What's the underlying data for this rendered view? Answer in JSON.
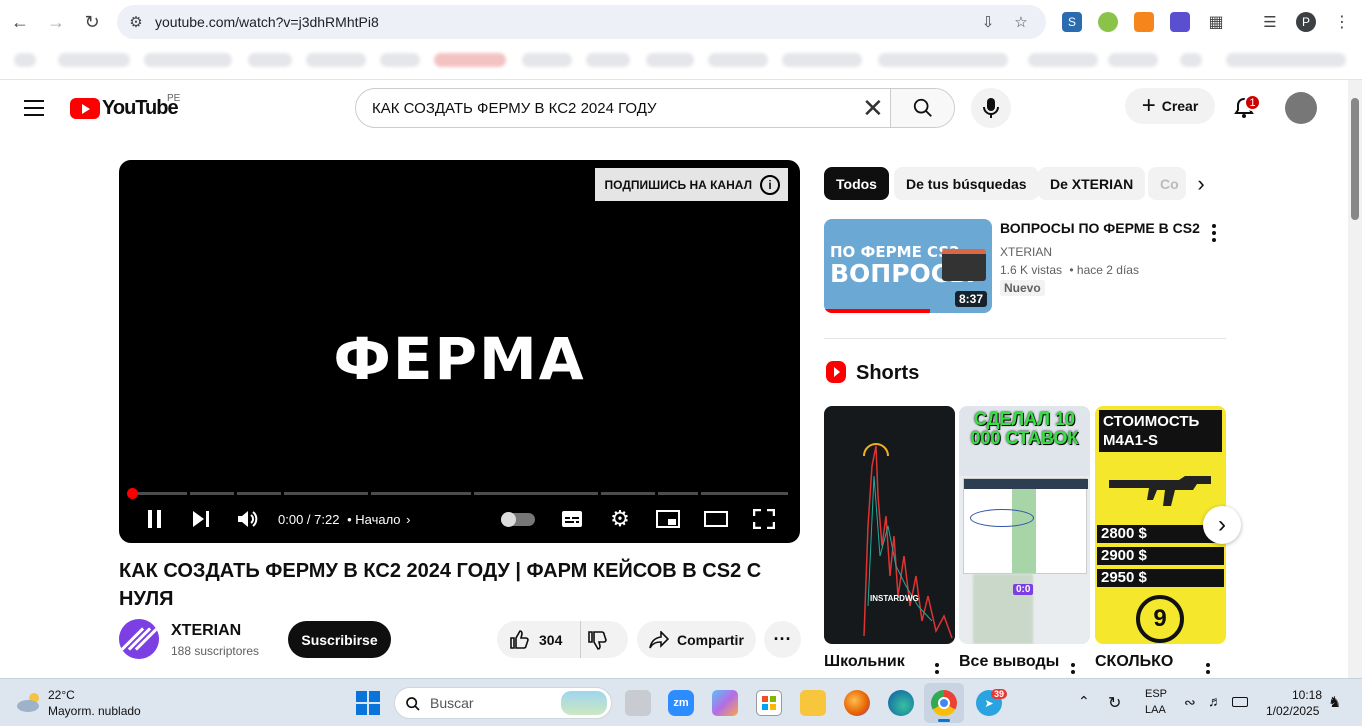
{
  "browser": {
    "url": "youtube.com/watch?v=j3dhRMhtPi8"
  },
  "header": {
    "logo_text": "YouTube",
    "country": "PE",
    "search_query": "КАК СОЗДАТЬ ФЕРМУ В КС2 2024 ГОДУ",
    "create_label": "Crear",
    "notification_count": "1"
  },
  "player": {
    "overlay_title": "ФЕРМА",
    "subscribe_banner": "ПОДПИШИСЬ НА КАНАЛ",
    "time": "0:00 / 7:22",
    "chapter": "• Начало",
    "progress": 0
  },
  "video": {
    "title": "КАК СОЗДАТЬ ФЕРМУ В КС2 2024 ГОДУ |  ФАРМ КЕЙСОВ В CS2 С НУЛЯ",
    "channel": "XTERIAN",
    "subscribers": "188 suscriptores",
    "subscribe_label": "Suscribirse",
    "likes": "304",
    "share_label": "Compartir"
  },
  "filters": {
    "chips": [
      "Todos",
      "De tus búsquedas",
      "De XTERIAN",
      "Co"
    ],
    "active": "Todos"
  },
  "recommended": {
    "thumb_line1": "ПО ФЕРМЕ CS2",
    "thumb_line2": "ВОПРОСЫ",
    "duration": "8:37",
    "title": "ВОПРОСЫ ПО ФЕРМЕ В CS2",
    "channel": "XTERIAN",
    "views": "1.6 K vistas",
    "age": "• hace 2 días",
    "badge": "Nuevo",
    "watch_progress": 0.63
  },
  "shorts": {
    "heading": "Shorts",
    "items": [
      {
        "title": "Школьник",
        "overlay": "INSTARDWG"
      },
      {
        "title": "Все выводы",
        "overlay": "СДЕЛАЛ 10 000 СТАВОК",
        "score": "0:0"
      },
      {
        "title": "СКОЛЬКО",
        "overlay": "СТОИМОСТЬ M4A1-S",
        "prices": [
          "2800 $",
          "2900 $",
          "2950 $"
        ],
        "number": "9"
      }
    ]
  },
  "taskbar": {
    "weather_temp": "22°C",
    "weather_desc": "Mayorm. nublado",
    "search_placeholder": "Buscar",
    "telegram_badge": "39",
    "lang1": "ESP",
    "lang2": "LAA",
    "time": "10:18",
    "date": "1/02/2025"
  },
  "colors": {
    "brand_red": "#ff0000",
    "chip_active": "#0f0f0f",
    "taskbar": "#dde5ef"
  }
}
